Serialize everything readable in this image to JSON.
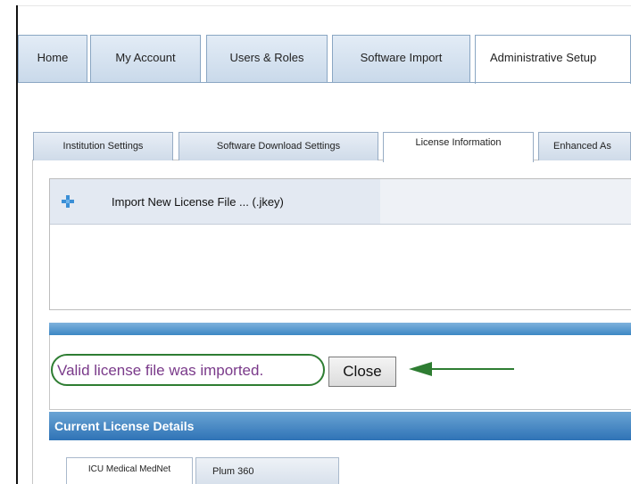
{
  "main_tabs": [
    {
      "label": "Home"
    },
    {
      "label": "My Account"
    },
    {
      "label": "Users & Roles"
    },
    {
      "label": "Software Import"
    },
    {
      "label": "Administrative Setup"
    }
  ],
  "sub_tabs": [
    {
      "label": "Institution Settings"
    },
    {
      "label": "Software Download Settings"
    },
    {
      "label": "License Information"
    },
    {
      "label": "Enhanced As"
    }
  ],
  "import": {
    "label": "Import New License File  ... (.jkey)",
    "icon": "plus-icon"
  },
  "status": {
    "message": "Valid license file was imported.",
    "close_label": "Close"
  },
  "details": {
    "header": "Current License Details",
    "tabs": [
      {
        "label": "ICU Medical MedNet"
      },
      {
        "label": "Plum 360"
      }
    ]
  },
  "colors": {
    "accent_blue": "#3d87c4",
    "annotation_green": "#2e7d32",
    "message_purple": "#7a3a8a"
  }
}
